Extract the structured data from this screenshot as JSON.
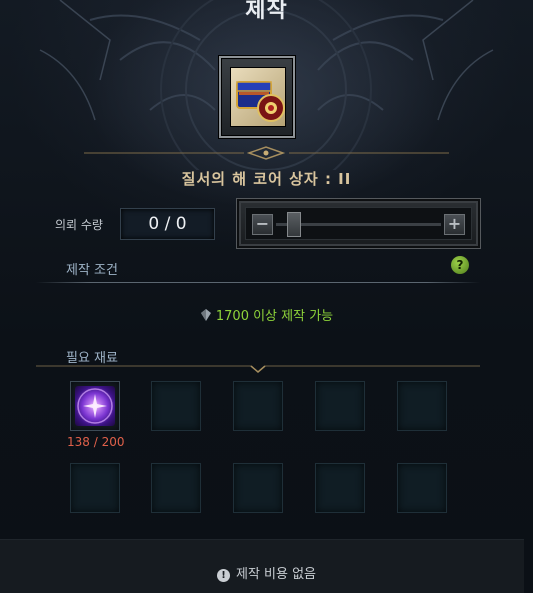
{
  "window": {
    "title": "제작"
  },
  "item": {
    "name": "질서의 해 코어 상자 : II",
    "icon": "treasure-chest-icon"
  },
  "quantity": {
    "label": "의뢰 수량",
    "value": "0 / 0",
    "slider_minus": "−",
    "slider_plus": "+"
  },
  "conditions": {
    "label": "제작 조건",
    "help_icon": "?",
    "requirement": "1700 이상 제작 가능"
  },
  "materials": {
    "label": "필요 재료",
    "items": [
      {
        "icon": "purple-orb-icon",
        "count": "138 / 200"
      }
    ]
  },
  "footer": {
    "info_icon": "!",
    "cost_text": "제작 비용 없음"
  },
  "colors": {
    "condition_text": "#8ed43a",
    "material_count": "#e0604a",
    "item_name": "#d9c59e"
  }
}
